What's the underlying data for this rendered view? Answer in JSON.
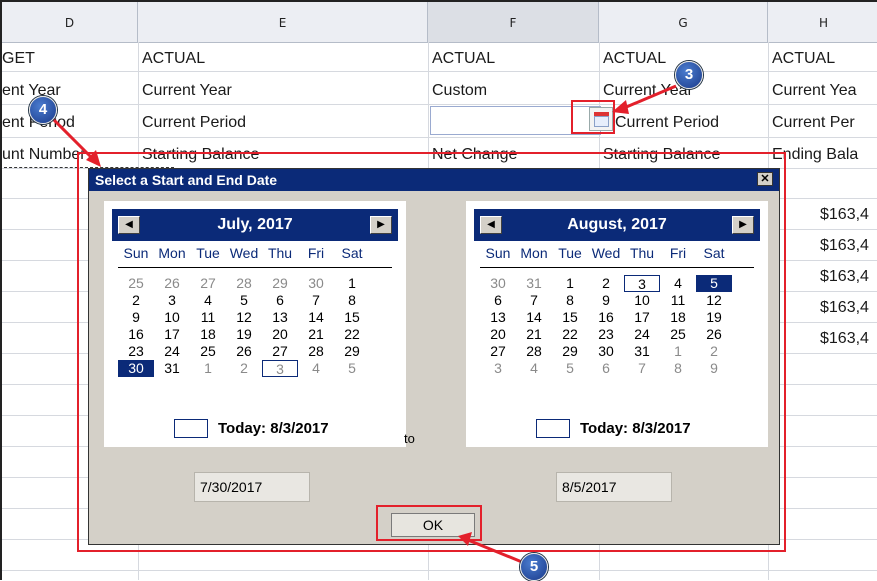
{
  "sheet": {
    "column_headers": [
      "D",
      "E",
      "F",
      "G",
      "H"
    ],
    "rows": [
      [
        "GET",
        "ACTUAL",
        "ACTUAL",
        "ACTUAL",
        "ACTUAL"
      ],
      [
        "ent Year",
        "Current Year",
        "Custom",
        "Current Year",
        "Current Yea"
      ],
      [
        "ent Period",
        "Current Period",
        "",
        "Current Period",
        "Current Per"
      ],
      [
        "unt Number",
        "Starting Balance",
        "Net Change",
        "Starting Balance",
        "Ending Bala"
      ]
    ],
    "h_values": [
      "$163,4",
      "$163,4",
      "$163,4",
      "$163,4",
      "$163,4"
    ]
  },
  "callouts": [
    "3",
    "4",
    "5"
  ],
  "dialog": {
    "title": "Select a Start and End Date",
    "close_glyph": "✕",
    "to_label": "to",
    "start_date": "7/30/2017",
    "end_date": "8/5/2017",
    "ok_label": "OK",
    "weekdays": [
      "Sun",
      "Mon",
      "Tue",
      "Wed",
      "Thu",
      "Fri",
      "Sat"
    ],
    "prev_glyph": "◀",
    "next_glyph": "▶",
    "left_calendar": {
      "month_label": "July, 2017",
      "today_label": "Today: 8/3/2017",
      "weeks": [
        [
          "25",
          "26",
          "27",
          "28",
          "29",
          "30",
          "1"
        ],
        [
          "2",
          "3",
          "4",
          "5",
          "6",
          "7",
          "8"
        ],
        [
          "9",
          "10",
          "11",
          "12",
          "13",
          "14",
          "15"
        ],
        [
          "16",
          "17",
          "18",
          "19",
          "20",
          "21",
          "22"
        ],
        [
          "23",
          "24",
          "25",
          "26",
          "27",
          "28",
          "29"
        ],
        [
          "30",
          "31",
          "1",
          "2",
          "3",
          "4",
          "5"
        ]
      ],
      "selected_day": "30"
    },
    "right_calendar": {
      "month_label": "August, 2017",
      "today_label": "Today: 8/3/2017",
      "weeks": [
        [
          "30",
          "31",
          "1",
          "2",
          "3",
          "4",
          "5"
        ],
        [
          "6",
          "7",
          "8",
          "9",
          "10",
          "11",
          "12"
        ],
        [
          "13",
          "14",
          "15",
          "16",
          "17",
          "18",
          "19"
        ],
        [
          "20",
          "21",
          "22",
          "23",
          "24",
          "25",
          "26"
        ],
        [
          "27",
          "28",
          "29",
          "30",
          "31",
          "1",
          "2"
        ],
        [
          "3",
          "4",
          "5",
          "6",
          "7",
          "8",
          "9"
        ]
      ],
      "selected_day": "5"
    }
  }
}
